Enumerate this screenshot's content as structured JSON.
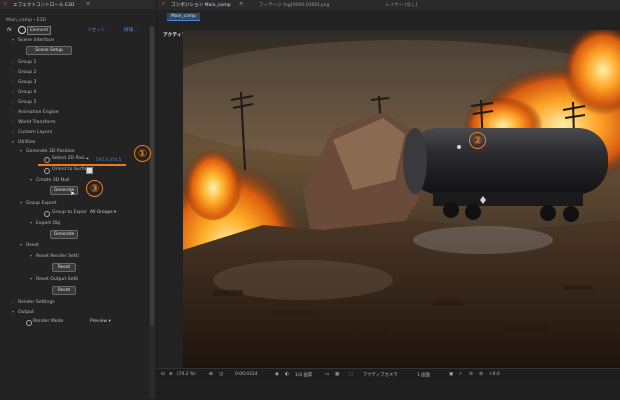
{
  "effects_panel": {
    "close": "×",
    "title": "エフェクトコントロール E3D",
    "menu": "≡",
    "comp_label": "Main_comp・E3D",
    "fx_icon": "fx",
    "effect_name": "Element",
    "reset": "リセット",
    "info": "情報...",
    "tree": [
      {
        "label": "Scene Interface",
        "arrow": "▾"
      },
      {
        "label": "Group 1",
        "arrow": "›"
      },
      {
        "label": "Group 2",
        "arrow": "›"
      },
      {
        "label": "Group 3",
        "arrow": "›"
      },
      {
        "label": "Group 4",
        "arrow": "›"
      },
      {
        "label": "Group 5",
        "arrow": "›"
      },
      {
        "label": "Animation Engine",
        "arrow": "›"
      },
      {
        "label": "World Transform",
        "arrow": "›"
      },
      {
        "label": "Custom Layers",
        "arrow": "›"
      },
      {
        "label": "Utilities",
        "arrow": "▾"
      },
      {
        "label": "Generate 3D Position",
        "arrow": "▾"
      },
      {
        "label": "Select 2D Posi",
        "arrow": ""
      },
      {
        "label": "Orient to Surfa",
        "arrow": ""
      },
      {
        "label": "Create 3D Null",
        "arrow": "▾"
      },
      {
        "label": "Group Export",
        "arrow": "▾"
      },
      {
        "label": "Group to Expor",
        "arrow": ""
      },
      {
        "label": "Export Obj",
        "arrow": "▾"
      },
      {
        "label": "Reset",
        "arrow": "▾"
      },
      {
        "label": "Reset Render Setti",
        "arrow": "▾"
      },
      {
        "label": "Reset Output Setti",
        "arrow": "▾"
      },
      {
        "label": "Render Settings",
        "arrow": "›"
      },
      {
        "label": "Output",
        "arrow": "▾"
      },
      {
        "label": "Render Mode",
        "arrow": ""
      }
    ],
    "buttons": {
      "scene_setup": "Scene Setup",
      "generate_null": "Generate",
      "generate_export": "Generate",
      "reset_render": "Reset",
      "reset_output": "Reset"
    },
    "select_value": "593.0,374.5",
    "group_export_value": "All Groups",
    "render_mode_value": "Preview",
    "annotations": [
      "①",
      "②",
      "③"
    ]
  },
  "viewer": {
    "tabs": [
      {
        "label": "コンポジション Main_comp",
        "active": true
      },
      {
        "label": "フッテージ fog[0000-0300].png",
        "active": false
      },
      {
        "label": "レイヤー (なし)",
        "active": false
      }
    ],
    "subtab": "Main_comp",
    "camera_label": "アクティブカメラ",
    "bottom_bar": {
      "zoom": "(74.2 %)",
      "timecode": "0:00:0314",
      "resolution": "1/4 画質",
      "camera": "アクティブカメラ",
      "views": "1 画面",
      "exposure": "+0.0"
    }
  },
  "colors": {
    "accent": "#f07a1a",
    "link": "#4a8ad8",
    "panel_bg": "#232323"
  }
}
